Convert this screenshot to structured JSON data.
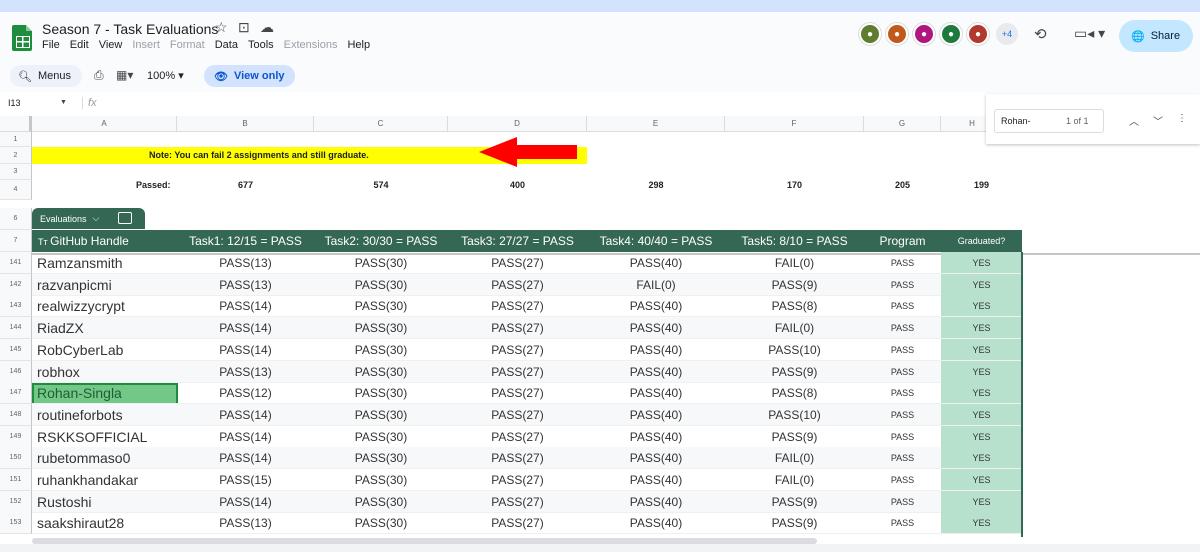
{
  "doc": {
    "title": "Season 7 - Task Evaluations"
  },
  "menu": [
    "File",
    "Edit",
    "View",
    "Insert",
    "Format",
    "Data",
    "Tools",
    "Extensions",
    "Help"
  ],
  "menu_disabled": [
    false,
    false,
    false,
    true,
    true,
    false,
    false,
    true,
    false
  ],
  "avatars": {
    "colors": [
      "#5f7d2e",
      "#c05a1b",
      "#b0177e",
      "#1e7a3c",
      "#b03a2e"
    ],
    "more": "+4"
  },
  "share": {
    "label": "Share"
  },
  "toolbar": {
    "menus_label": "Menus",
    "zoom": "100%",
    "view_only": "View only"
  },
  "formula": {
    "cell_ref": "I13",
    "fx": "fx"
  },
  "find": {
    "query": "Rohan-",
    "count": "1 of 1"
  },
  "columns": [
    "A",
    "B",
    "C",
    "D",
    "E",
    "F",
    "G",
    "H"
  ],
  "top_rows": [
    "1",
    "2",
    "3",
    "4",
    "6",
    "7"
  ],
  "note": "Note:  You can fail 2 assignments and still graduate.",
  "passed": {
    "label": "Passed:",
    "values": [
      "677",
      "574",
      "400",
      "298",
      "170",
      "205",
      "199"
    ]
  },
  "table_tab": {
    "label": "Evaluations"
  },
  "headers": [
    "GitHub Handle",
    "Task1: 12/15 = PASS",
    "Task2: 30/30 = PASS",
    "Task3: 27/27 = PASS",
    "Task4: 40/40 = PASS",
    "Task5: 8/10 = PASS",
    "Program",
    "Graduated?"
  ],
  "rows": [
    {
      "num": "141",
      "cells": [
        "Ramzansmith",
        "PASS(13)",
        "PASS(30)",
        "PASS(27)",
        "PASS(40)",
        "FAIL(0)",
        "PASS",
        "YES"
      ]
    },
    {
      "num": "142",
      "cells": [
        "razvanpicmi",
        "PASS(13)",
        "PASS(30)",
        "PASS(27)",
        "FAIL(0)",
        "PASS(9)",
        "PASS",
        "YES"
      ]
    },
    {
      "num": "143",
      "cells": [
        "realwizzycrypt",
        "PASS(14)",
        "PASS(30)",
        "PASS(27)",
        "PASS(40)",
        "PASS(8)",
        "PASS",
        "YES"
      ]
    },
    {
      "num": "144",
      "cells": [
        "RiadZX",
        "PASS(14)",
        "PASS(30)",
        "PASS(27)",
        "PASS(40)",
        "FAIL(0)",
        "PASS",
        "YES"
      ]
    },
    {
      "num": "145",
      "cells": [
        "RobCyberLab",
        "PASS(14)",
        "PASS(30)",
        "PASS(27)",
        "PASS(40)",
        "PASS(10)",
        "PASS",
        "YES"
      ]
    },
    {
      "num": "146",
      "cells": [
        "robhox",
        "PASS(13)",
        "PASS(30)",
        "PASS(27)",
        "PASS(40)",
        "PASS(9)",
        "PASS",
        "YES"
      ]
    },
    {
      "num": "147",
      "cells": [
        "Rohan-Singla",
        "PASS(12)",
        "PASS(30)",
        "PASS(27)",
        "PASS(40)",
        "PASS(8)",
        "PASS",
        "YES"
      ]
    },
    {
      "num": "148",
      "cells": [
        "routineforbots",
        "PASS(14)",
        "PASS(30)",
        "PASS(27)",
        "PASS(40)",
        "PASS(10)",
        "PASS",
        "YES"
      ]
    },
    {
      "num": "149",
      "cells": [
        "RSKKSOFFICIAL",
        "PASS(14)",
        "PASS(30)",
        "PASS(27)",
        "PASS(40)",
        "PASS(9)",
        "PASS",
        "YES"
      ]
    },
    {
      "num": "150",
      "cells": [
        "rubetommaso0",
        "PASS(14)",
        "PASS(30)",
        "PASS(27)",
        "PASS(40)",
        "FAIL(0)",
        "PASS",
        "YES"
      ]
    },
    {
      "num": "151",
      "cells": [
        "ruhankhandakar",
        "PASS(15)",
        "PASS(30)",
        "PASS(27)",
        "PASS(40)",
        "FAIL(0)",
        "PASS",
        "YES"
      ]
    },
    {
      "num": "152",
      "cells": [
        "Rustoshi",
        "PASS(14)",
        "PASS(30)",
        "PASS(27)",
        "PASS(40)",
        "PASS(9)",
        "PASS",
        "YES"
      ]
    },
    {
      "num": "153",
      "cells": [
        "saakshiraut28",
        "PASS(13)",
        "PASS(30)",
        "PASS(27)",
        "PASS(40)",
        "PASS(9)",
        "PASS",
        "YES"
      ]
    }
  ],
  "selected_row": "147"
}
